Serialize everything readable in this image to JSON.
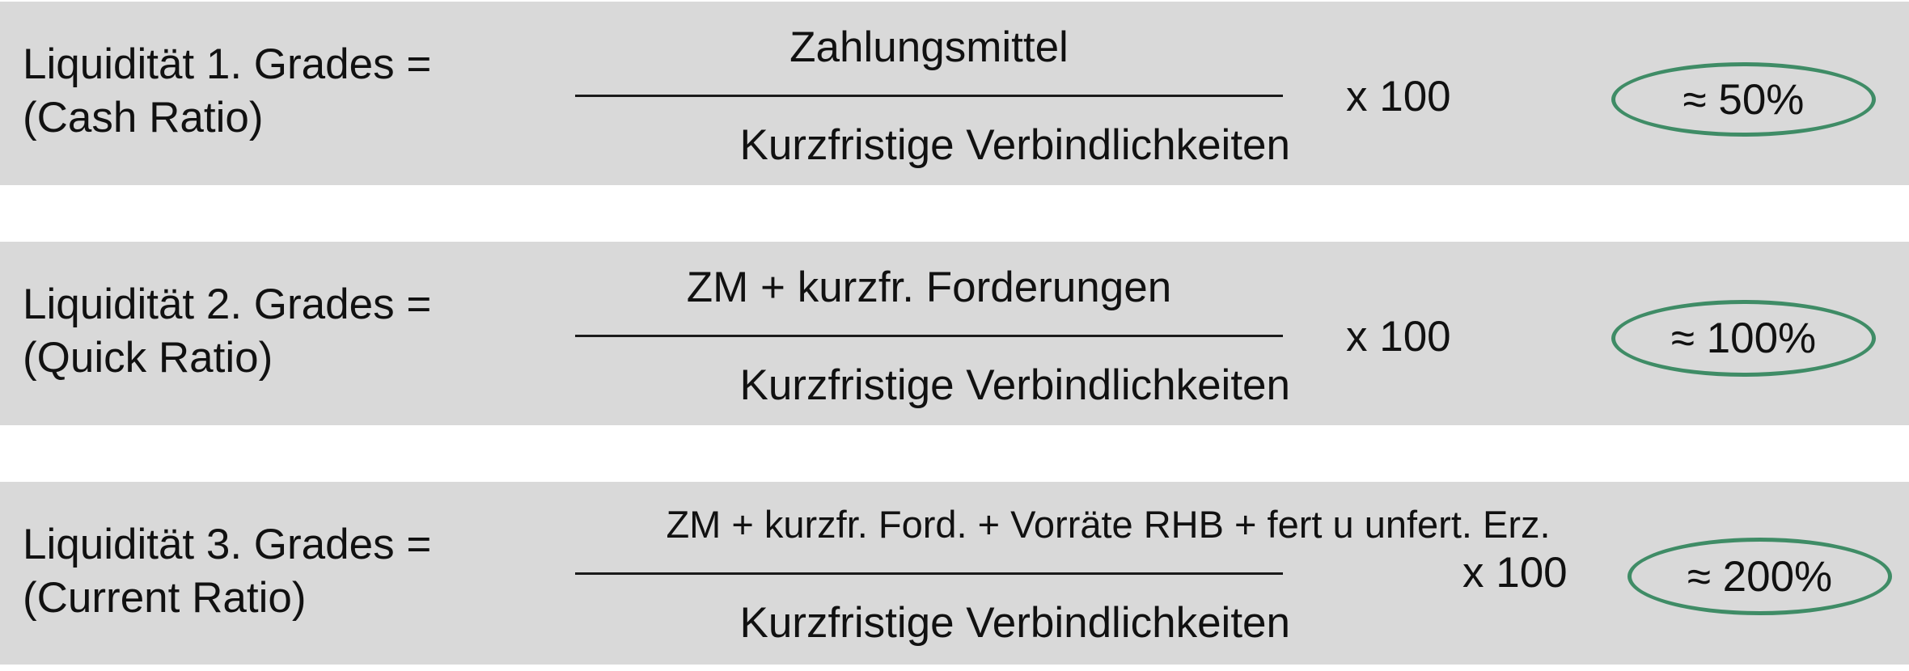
{
  "ratios": [
    {
      "label_line1": "Liquidität 1. Grades =",
      "label_line2": "(Cash Ratio)",
      "numerator": "Zahlungsmittel",
      "denominator": "Kurzfristige Verbindlichkeiten",
      "multiplier": "x 100",
      "result": "≈ 50%"
    },
    {
      "label_line1": "Liquidität 2. Grades =",
      "label_line2": "(Quick Ratio)",
      "numerator": "ZM + kurzfr. Forderungen",
      "denominator": "Kurzfristige Verbindlichkeiten",
      "multiplier": "x 100",
      "result": "≈ 100%"
    },
    {
      "label_line1": "Liquidität 3. Grades =",
      "label_line2": "(Current Ratio)",
      "numerator": "ZM + kurzfr. Ford. + Vorräte RHB + fert u unfert. Erz.",
      "denominator": "Kurzfristige Verbindlichkeiten",
      "multiplier": "x 100",
      "result": "≈ 200%"
    }
  ],
  "colors": {
    "panel_background": "#d9d9d9",
    "result_ellipse": "#3f8c66",
    "text": "#111111"
  }
}
